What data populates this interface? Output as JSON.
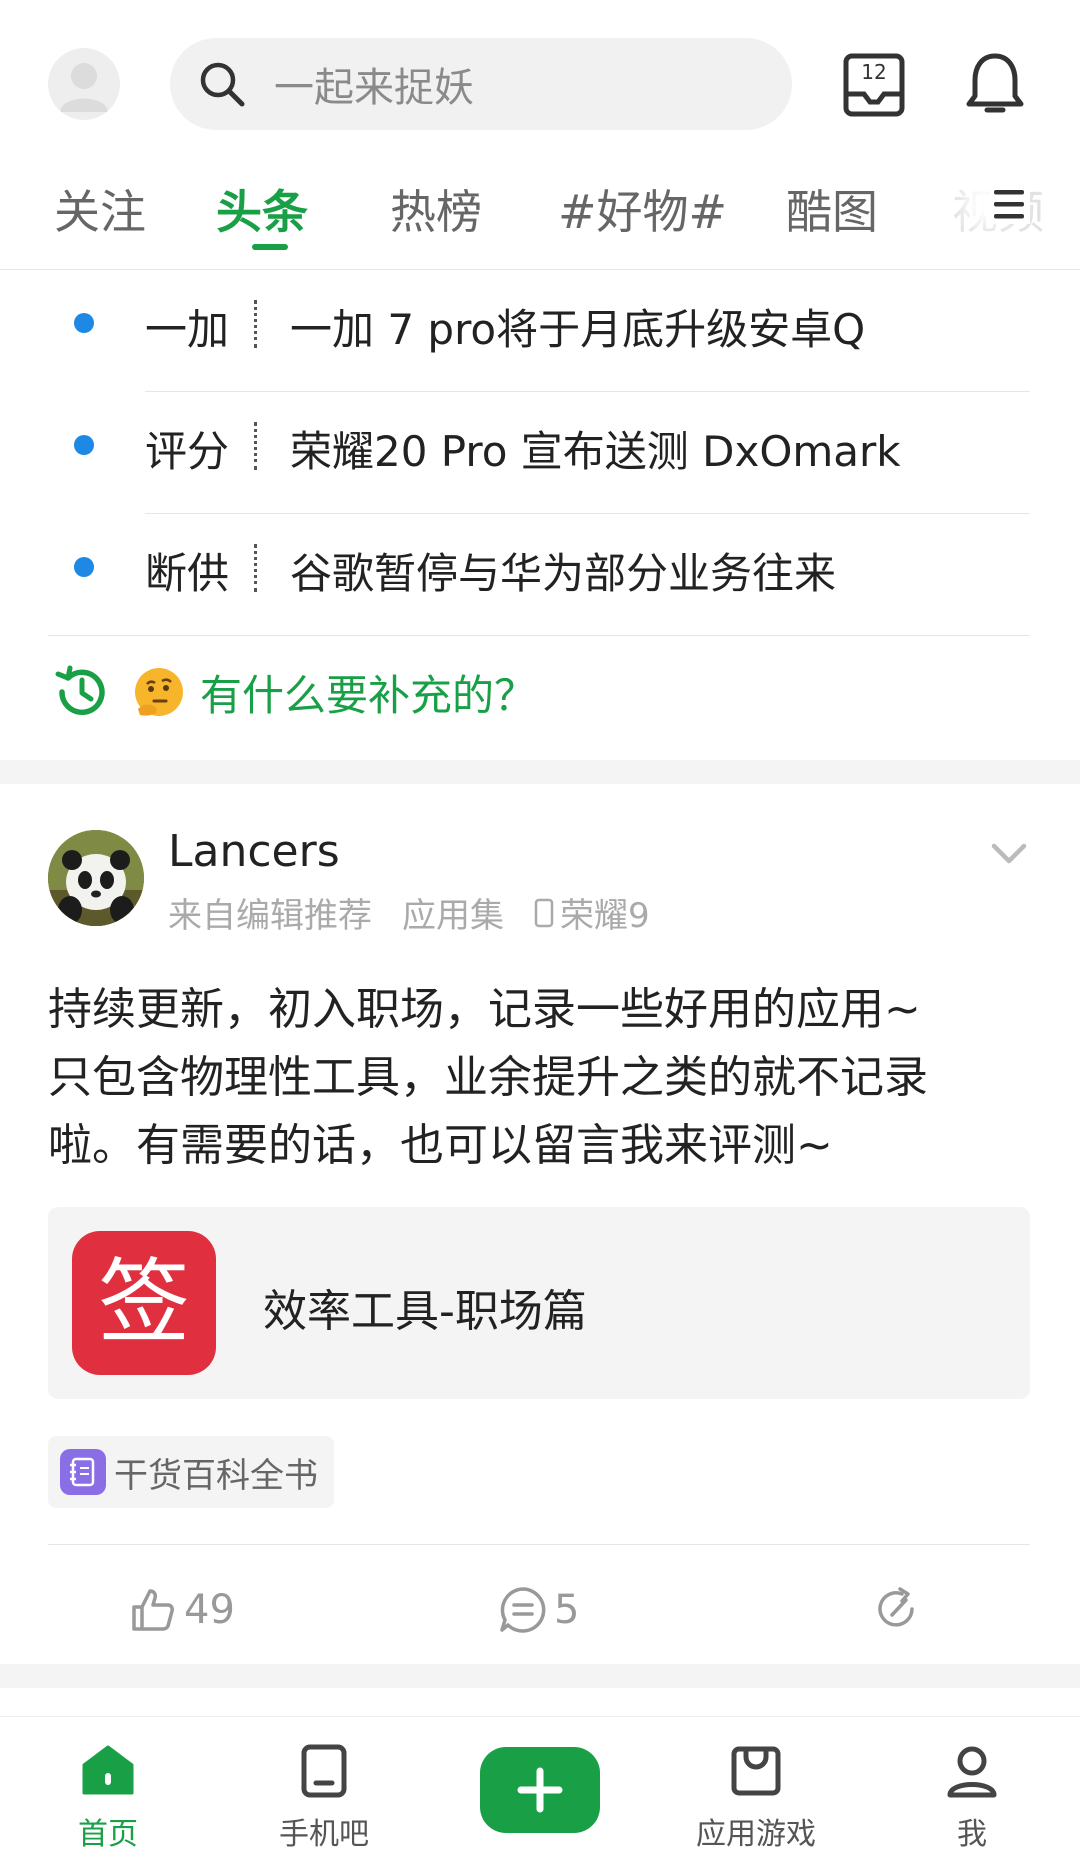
{
  "header": {
    "search_placeholder": "一起来捉妖",
    "calendar_day": "12"
  },
  "tabs": [
    "关注",
    "头条",
    "热榜",
    "#好物#",
    "酷图",
    "视频"
  ],
  "active_tab": "头条",
  "headlines": [
    {
      "tag": "一加",
      "title": "一加 7 pro将于月底升级安卓Q"
    },
    {
      "tag": "评分",
      "title": "荣耀20 Pro 宣布送测 DxOmark"
    },
    {
      "tag": "断供",
      "title": "谷歌暂停与华为部分业务往来"
    }
  ],
  "supplement_prompt": "有什么要补充的？",
  "post": {
    "username": "Lancers",
    "source": "来自编辑推荐",
    "category": "应用集",
    "device": "荣耀9",
    "body_lines": [
      "持续更新，初入职场，记录一些好用的应用~",
      "只包含物理性工具，业余提升之类的就不记录",
      "啦。有需要的话，也可以留言我来评测~"
    ],
    "collection": {
      "icon_char": "签",
      "title": "效率工具-职场篇"
    },
    "topic": "干货百科全书",
    "likes": "49",
    "comments": "5"
  },
  "bottom_nav": [
    {
      "label": "首页",
      "icon": "home-icon"
    },
    {
      "label": "手机吧",
      "icon": "phone-icon"
    },
    {
      "label": "",
      "icon": "plus-icon"
    },
    {
      "label": "应用游戏",
      "icon": "bag-icon"
    },
    {
      "label": "我",
      "icon": "user-icon"
    }
  ],
  "colors": {
    "accent": "#19a047",
    "headline_dot": "#1e88e5",
    "collection_icon_bg": "#e0303f"
  }
}
